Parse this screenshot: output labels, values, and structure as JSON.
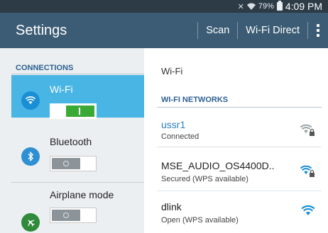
{
  "status_bar": {
    "battery_percent": "79%",
    "time": "4:09 PM"
  },
  "action_bar": {
    "title": "Settings",
    "scan_label": "Scan",
    "wifi_direct_label": "Wi-Fi Direct"
  },
  "connections": {
    "header": "CONNECTIONS",
    "items": [
      {
        "label": "Wi-Fi",
        "icon": "wifi-icon",
        "enabled": true
      },
      {
        "label": "Bluetooth",
        "icon": "bluetooth-icon",
        "enabled": false
      },
      {
        "label": "Airplane mode",
        "icon": "airplane-icon",
        "enabled": false
      }
    ]
  },
  "wifi_panel": {
    "title": "Wi-Fi",
    "networks_header": "WI-FI NETWORKS",
    "networks": [
      {
        "name": "ussr1",
        "status": "Connected",
        "secured": true
      },
      {
        "name": "MSE_AUDIO_OS4400D..",
        "status": "Secured (WPS available)",
        "secured": true
      },
      {
        "name": "dlink",
        "status": "Open (WPS available)",
        "secured": false
      }
    ]
  },
  "colors": {
    "action_bar": "#3b5c74",
    "status_bar": "#2d3b47",
    "active_item": "#48b5e4",
    "toggle_on": "#3aaa35",
    "section_header": "#2b5f92",
    "wifi_blue": "#1a8fd6"
  }
}
